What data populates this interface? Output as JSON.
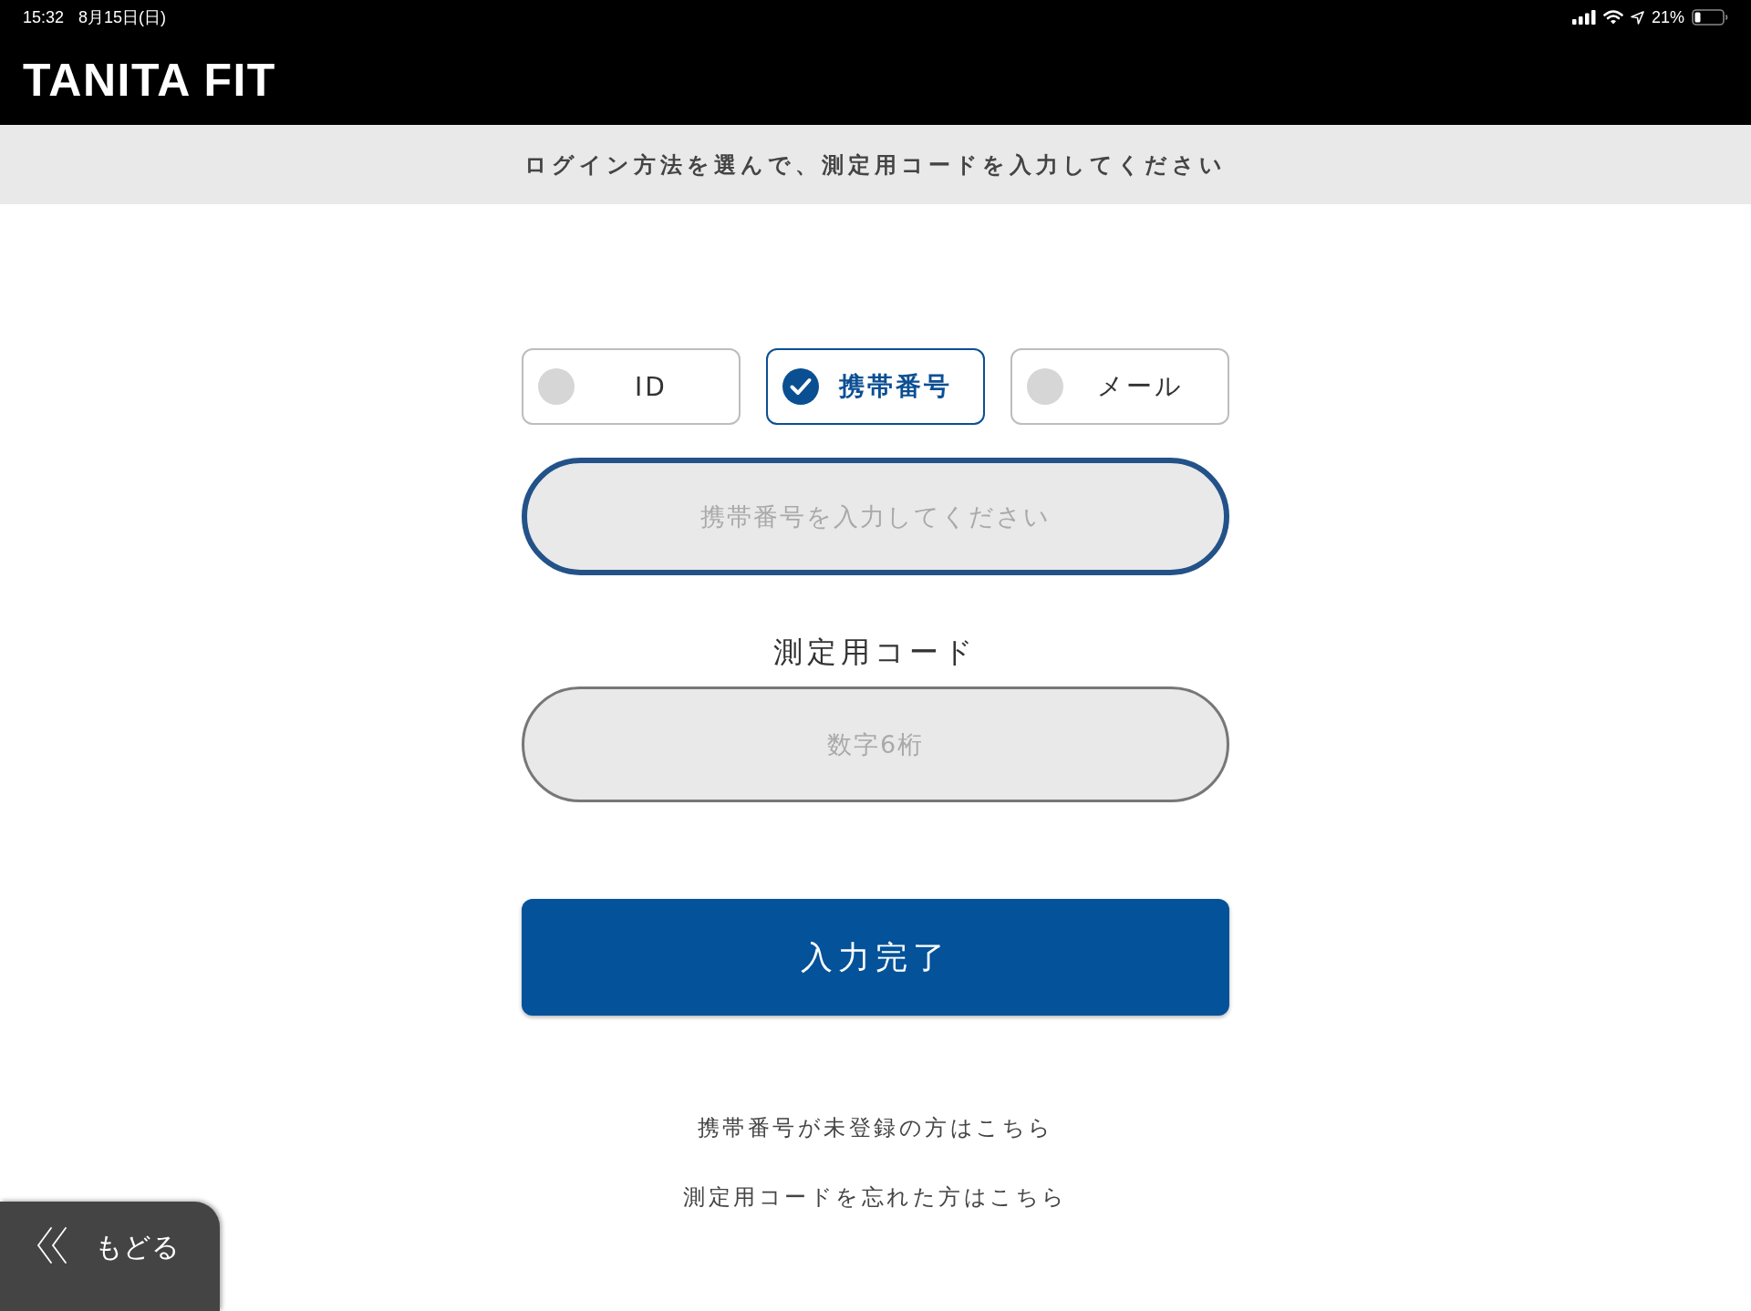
{
  "status_bar": {
    "time": "15:32",
    "date": "8月15日(日)",
    "battery": "21%"
  },
  "header": {
    "logo": "TANITA FIT"
  },
  "banner": {
    "text": "ログイン方法を選んで、測定用コードを入力してください"
  },
  "login_methods": [
    {
      "label": "ID",
      "selected": false
    },
    {
      "label": "携帯番号",
      "selected": true
    },
    {
      "label": "メール",
      "selected": false
    }
  ],
  "phone_field": {
    "placeholder": "携帯番号を入力してください",
    "focused": true
  },
  "code_field": {
    "label": "測定用コード",
    "placeholder": "数字6桁",
    "focused": false
  },
  "submit_button": {
    "label": "入力完了"
  },
  "links": [
    "携帯番号が未登録の方はこちら",
    "測定用コードを忘れた方はこちら"
  ],
  "back_button": {
    "label": "もどる"
  }
}
